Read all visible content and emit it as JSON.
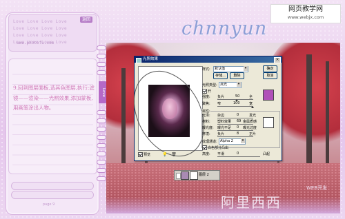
{
  "watermark_top": {
    "line1": "网页教学网",
    "line2": "www.webjx.com"
  },
  "header": {
    "title": "chnnyun"
  },
  "notebook": {
    "back_label": "返回",
    "paper_lines": [
      "Love Love Love Love",
      "Love Love Love Love",
      "Love Love Love Love",
      "Love Love Love Love"
    ],
    "site": "www.photofu.com",
    "tab_label": "Love",
    "body_text": "9.回到图层面板,选其色图层,执行:滤镜——渲染——光照效果,添加蒙板,用画笔涂出人物。",
    "page_label": "page 9"
  },
  "dialog": {
    "title": "光照效果",
    "close": "×",
    "style_label": "样式:",
    "style_value": "默认值",
    "ok": "确定",
    "cancel": "取消",
    "save": "存储...",
    "delete": "删除",
    "light_type_label": "光照类型:",
    "light_type_value": "点光",
    "on_label": "开",
    "intensity_label": "强度:",
    "intensity_neg": "负片",
    "intensity_value": "50",
    "intensity_pos": "全",
    "focus_label": "聚焦:",
    "focus_narrow": "窄",
    "focus_value": "100",
    "focus_wide": "宽",
    "properties_label": "属性:",
    "gloss_label": "光泽:",
    "gloss_left": "杂边",
    "gloss_value": "0",
    "gloss_right": "发光",
    "material_label": "材料:",
    "material_left": "塑料效果",
    "material_value": "69",
    "material_right": "金属质感",
    "exposure_label": "曝光度:",
    "exposure_left": "曝光不足",
    "exposure_value": "0",
    "exposure_right": "曝光过度",
    "ambience_label": "环境:",
    "ambience_left": "负片",
    "ambience_value": "8",
    "ambience_right": "正片",
    "texture_label": "纹理通道:",
    "texture_value": "Alpha 2",
    "white_high_label": "白色部分凸出",
    "height_label": "高度:",
    "height_left": "平滑",
    "height_value": "0",
    "height_right": "凸起",
    "preview_label": "预览",
    "swatch_color": "#b04fb8",
    "swatch2_color": "#ffffff"
  },
  "layer_strip": {
    "label": "图层 2"
  },
  "watermark_bottom": {
    "text": "阿里西西",
    "small": "WEB开发"
  }
}
